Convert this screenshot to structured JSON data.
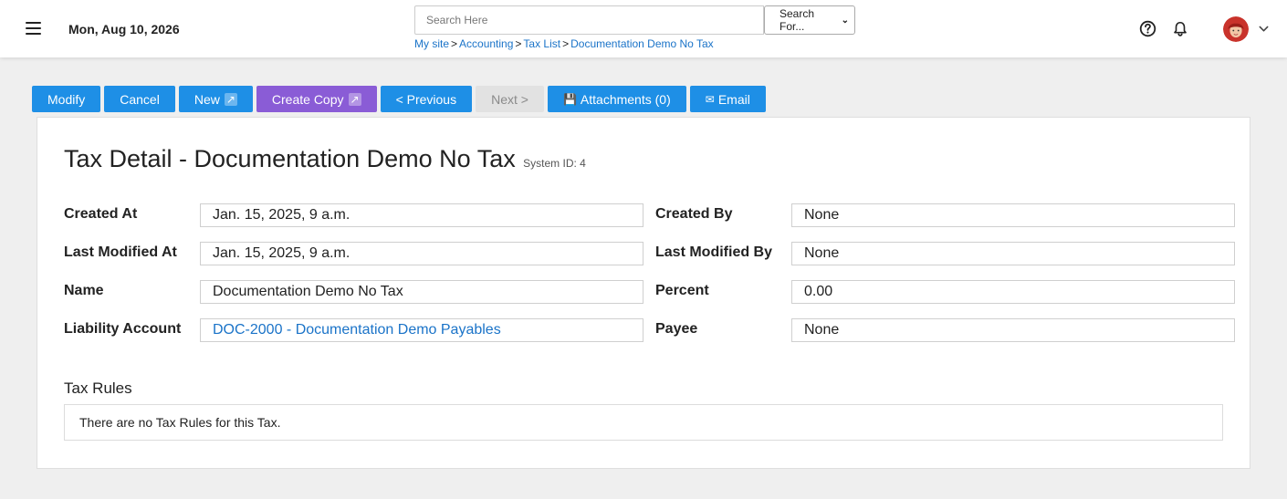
{
  "header": {
    "date": "Mon, Aug 10, 2026",
    "search": {
      "placeholder": "Search Here",
      "select_value": "Search For..."
    },
    "breadcrumb": [
      "My site",
      "Accounting",
      "Tax List",
      "Documentation Demo No Tax"
    ],
    "breadcrumb_separator": ">"
  },
  "toolbar": {
    "modify": "Modify",
    "cancel": "Cancel",
    "new": "New",
    "create_copy": "Create Copy",
    "previous": "< Previous",
    "next": "Next >",
    "attachments": "Attachments (0)",
    "email": "Email"
  },
  "detail": {
    "title": "Tax Detail - Documentation Demo No Tax",
    "system_id": "System ID: 4",
    "fields": {
      "created_at": {
        "label": "Created At",
        "value": "Jan. 15, 2025, 9 a.m."
      },
      "created_by": {
        "label": "Created By",
        "value": "None"
      },
      "last_modified_at": {
        "label": "Last Modified At",
        "value": "Jan. 15, 2025, 9 a.m."
      },
      "last_modified_by": {
        "label": "Last Modified By",
        "value": "None"
      },
      "name": {
        "label": "Name",
        "value": "Documentation Demo No Tax"
      },
      "percent": {
        "label": "Percent",
        "value": "0.00"
      },
      "liability_account": {
        "label": "Liability Account",
        "value": "DOC-2000 - Documentation Demo Payables"
      },
      "payee": {
        "label": "Payee",
        "value": "None"
      }
    }
  },
  "tax_rules": {
    "heading": "Tax Rules",
    "empty_message": "There are no Tax Rules for this Tax."
  },
  "colors": {
    "primary_button": "#1e8fe6",
    "copy_button": "#8a5cd6",
    "disabled_button": "#e2e2e2",
    "link": "#1a73c8",
    "page_background": "#efefef"
  },
  "icons": {
    "menu": "hamburger-menu-icon",
    "help": "help-circle-icon",
    "notifications": "bell-icon",
    "account_menu": "chevron-down-icon",
    "external": "external-link-icon",
    "attachments": "floppy-disk-icon",
    "email": "envelope-icon"
  }
}
